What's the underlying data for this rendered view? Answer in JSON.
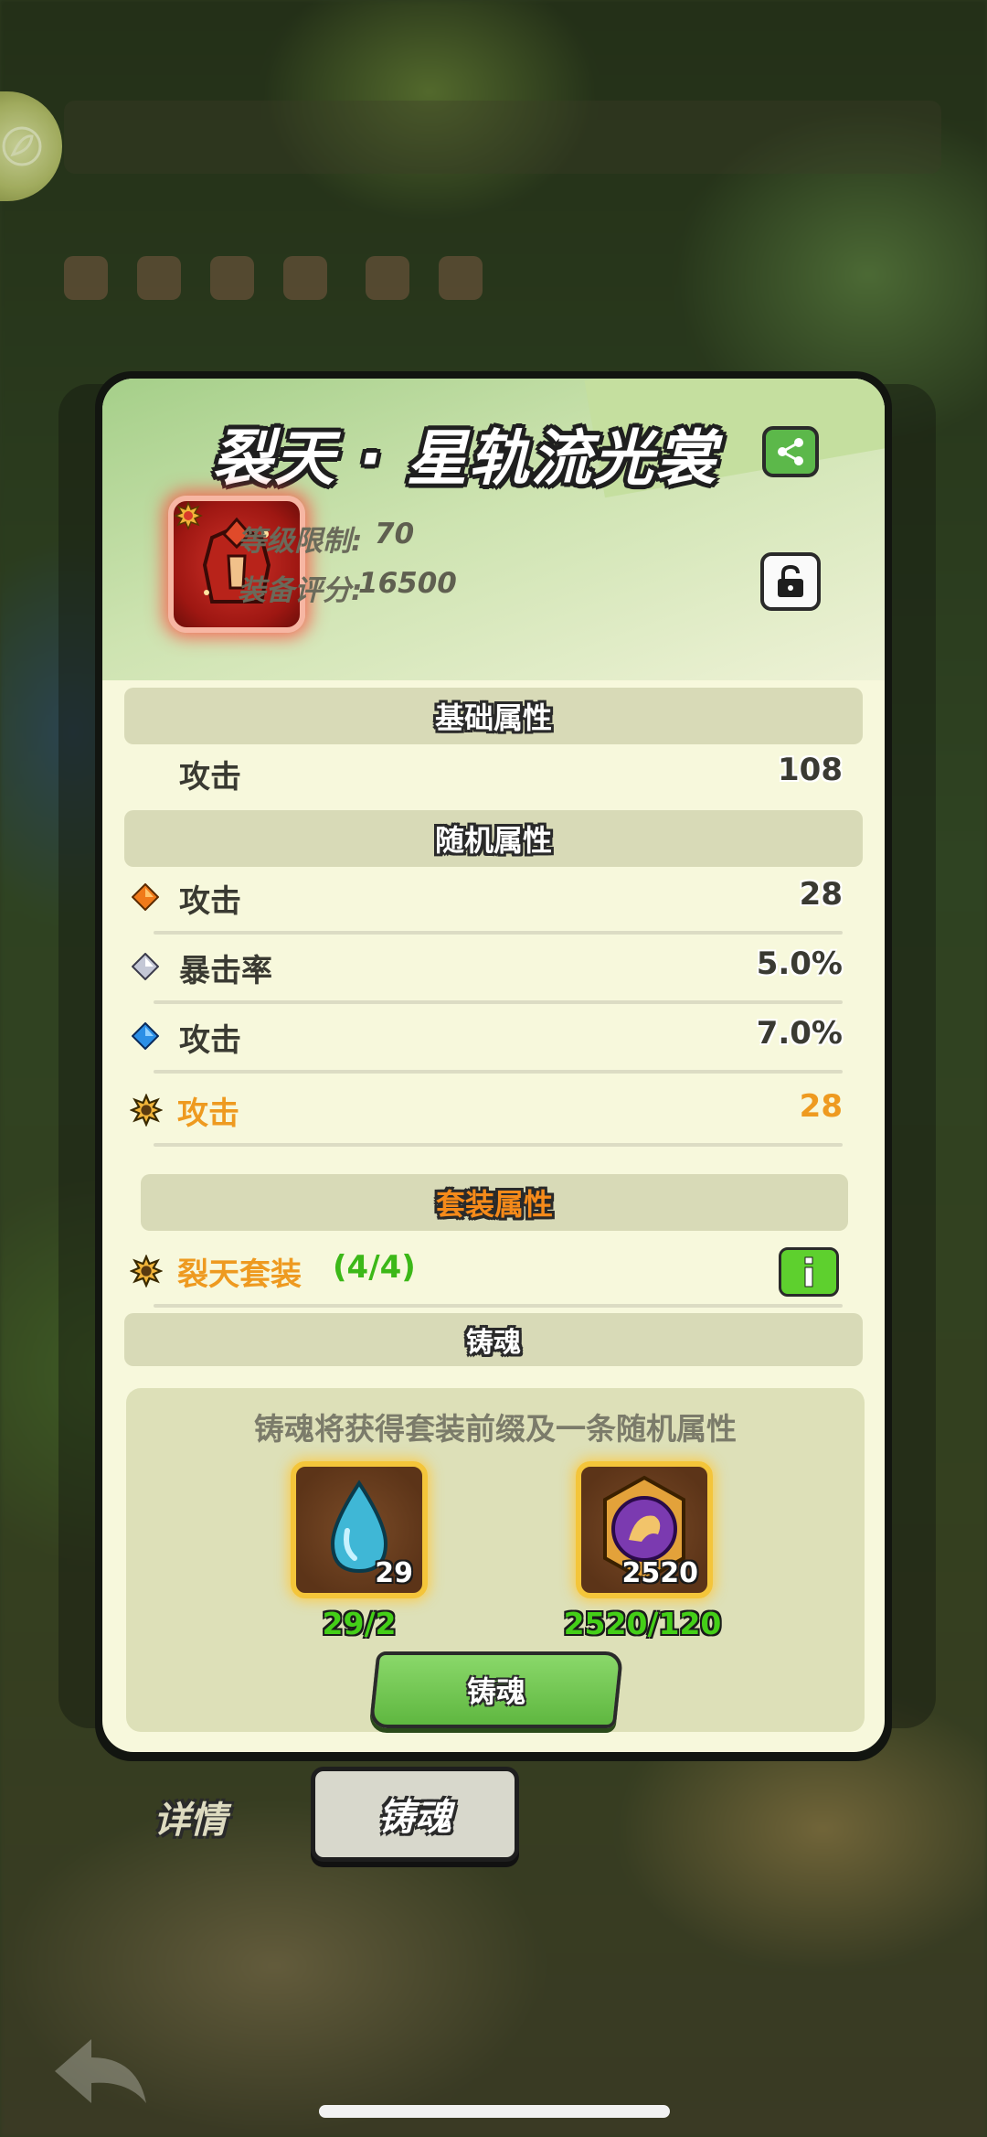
{
  "title": "裂天 · 星轨流光裳",
  "level_limit": {
    "label": "等级限制:",
    "value": "70"
  },
  "equip_score": {
    "label": "装备评分:",
    "value": "16500"
  },
  "base_section": {
    "title": "基础属性",
    "rows": [
      {
        "label": "攻击",
        "value": "108"
      }
    ]
  },
  "random_section": {
    "title": "随机属性",
    "rows": [
      {
        "gem": "orange-gem-icon",
        "label": "攻击",
        "value": "28"
      },
      {
        "gem": "silver-gem-icon",
        "label": "暴击率",
        "value": "5.0%"
      },
      {
        "gem": "blue-gem-icon",
        "label": "攻击",
        "value": "7.0%"
      },
      {
        "gem": "set-gear-icon",
        "label": "攻击",
        "value": "28"
      }
    ]
  },
  "set_section": {
    "title": "套装属性",
    "set_name": "裂天套装",
    "set_count": "(4/4)"
  },
  "forge_section": {
    "title": "铸魂",
    "description": "铸魂将获得套装前缀及一条随机属性",
    "materials": [
      {
        "icon": "water-drop-icon",
        "count": "29",
        "need": "29/2"
      },
      {
        "icon": "soul-medal-icon",
        "count": "2520",
        "need": "2520/120"
      }
    ],
    "button_label": "铸魂"
  },
  "tabs": {
    "detail": "详情",
    "forge": "铸魂"
  },
  "colors": {
    "accent_green": "#5cb84a",
    "set_orange": "#ee9a20",
    "set_count_green": "#3cb818",
    "card_bg": "#f7f8dc"
  }
}
